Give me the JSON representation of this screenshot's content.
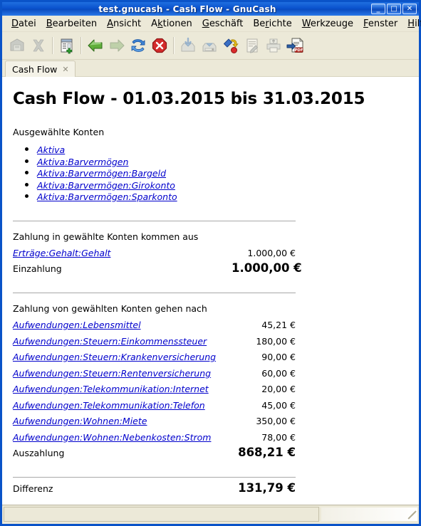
{
  "window": {
    "title": "test.gnucash - Cash Flow - GnuCash",
    "buttons": {
      "minimize": "_",
      "maximize": "□",
      "close": "✕"
    }
  },
  "menubar": {
    "items": [
      {
        "label": "Datei",
        "pre": "",
        "mn": "D",
        "post": "atei"
      },
      {
        "label": "Bearbeiten",
        "pre": "",
        "mn": "B",
        "post": "earbeiten"
      },
      {
        "label": "Ansicht",
        "pre": "",
        "mn": "A",
        "post": "nsicht"
      },
      {
        "label": "Aktionen",
        "pre": "A",
        "mn": "k",
        "post": "tionen"
      },
      {
        "label": "Geschäft",
        "pre": "",
        "mn": "G",
        "post": "eschäft"
      },
      {
        "label": "Berichte",
        "pre": "Be",
        "mn": "r",
        "post": "ichte"
      },
      {
        "label": "Werkzeuge",
        "pre": "",
        "mn": "W",
        "post": "erkzeuge"
      },
      {
        "label": "Fenster",
        "pre": "",
        "mn": "F",
        "post": "enster"
      },
      {
        "label": "Hilfe",
        "pre": "",
        "mn": "H",
        "post": "ilfe"
      }
    ]
  },
  "toolbar": {
    "items": [
      {
        "name": "save-icon",
        "tooltip": "Speichern",
        "enabled": false
      },
      {
        "name": "close-icon",
        "tooltip": "Schließen",
        "enabled": false
      },
      {
        "name": "new-report-icon",
        "tooltip": "Neuer Bericht",
        "enabled": true
      },
      {
        "name": "back-arrow-icon",
        "tooltip": "Zurück",
        "enabled": true
      },
      {
        "name": "forward-arrow-icon",
        "tooltip": "Vorwärts",
        "enabled": false
      },
      {
        "name": "reload-icon",
        "tooltip": "Aktualisieren",
        "enabled": true
      },
      {
        "name": "stop-icon",
        "tooltip": "Abbrechen",
        "enabled": true
      },
      {
        "name": "export-icon",
        "tooltip": "Exportieren",
        "enabled": false
      },
      {
        "name": "save-as-icon",
        "tooltip": "Speichern unter",
        "enabled": false
      },
      {
        "name": "report-options-icon",
        "tooltip": "Berichtsoptionen",
        "enabled": true
      },
      {
        "name": "edit-report-icon",
        "tooltip": "Bericht bearbeiten",
        "enabled": false
      },
      {
        "name": "print-icon",
        "tooltip": "Drucken",
        "enabled": false
      },
      {
        "name": "export-pdf-icon",
        "tooltip": "Als PDF exportieren",
        "enabled": true
      }
    ]
  },
  "tabs": [
    {
      "label": "Cash Flow",
      "close": "✕",
      "active": true
    }
  ],
  "report": {
    "title": "Cash Flow - 01.03.2015 bis 31.03.2015",
    "selected_accounts_label": "Ausgewählte Konten",
    "selected_accounts": [
      "Aktiva",
      "Aktiva:Barvermögen",
      "Aktiva:Barvermögen:Bargeld",
      "Aktiva:Barvermögen:Girokonto",
      "Aktiva:Barvermögen:Sparkonto"
    ],
    "inflow": {
      "heading": "Zahlung in gewählte Konten kommen aus",
      "rows": [
        {
          "account": "Erträge:Gehalt:Gehalt",
          "amount": "1.000,00 €"
        }
      ],
      "total_label": "Einzahlung",
      "total_amount": "1.000,00 €"
    },
    "outflow": {
      "heading": "Zahlung von gewählten Konten gehen nach",
      "rows": [
        {
          "account": "Aufwendungen:Lebensmittel",
          "amount": "45,21 €"
        },
        {
          "account": "Aufwendungen:Steuern:Einkommenssteuer",
          "amount": "180,00 €"
        },
        {
          "account": "Aufwendungen:Steuern:Krankenversicherung",
          "amount": "90,00 €"
        },
        {
          "account": "Aufwendungen:Steuern:Rentenversicherung",
          "amount": "60,00 €"
        },
        {
          "account": "Aufwendungen:Telekommunikation:Internet",
          "amount": "20,00 €"
        },
        {
          "account": "Aufwendungen:Telekommunikation:Telefon",
          "amount": "45,00 €"
        },
        {
          "account": "Aufwendungen:Wohnen:Miete",
          "amount": "350,00 €"
        },
        {
          "account": "Aufwendungen:Wohnen:Nebenkosten:Strom",
          "amount": "78,00 €"
        }
      ],
      "total_label": "Auszahlung",
      "total_amount": "868,21 €"
    },
    "difference": {
      "label": "Differenz",
      "amount": "131,79 €"
    }
  },
  "statusbar": {
    "message": ""
  },
  "colors": {
    "titlebar": "#0a52cd",
    "chrome": "#ece9d8",
    "link": "#0000cc",
    "rule": "#a8a8a8",
    "text": "#000000"
  }
}
